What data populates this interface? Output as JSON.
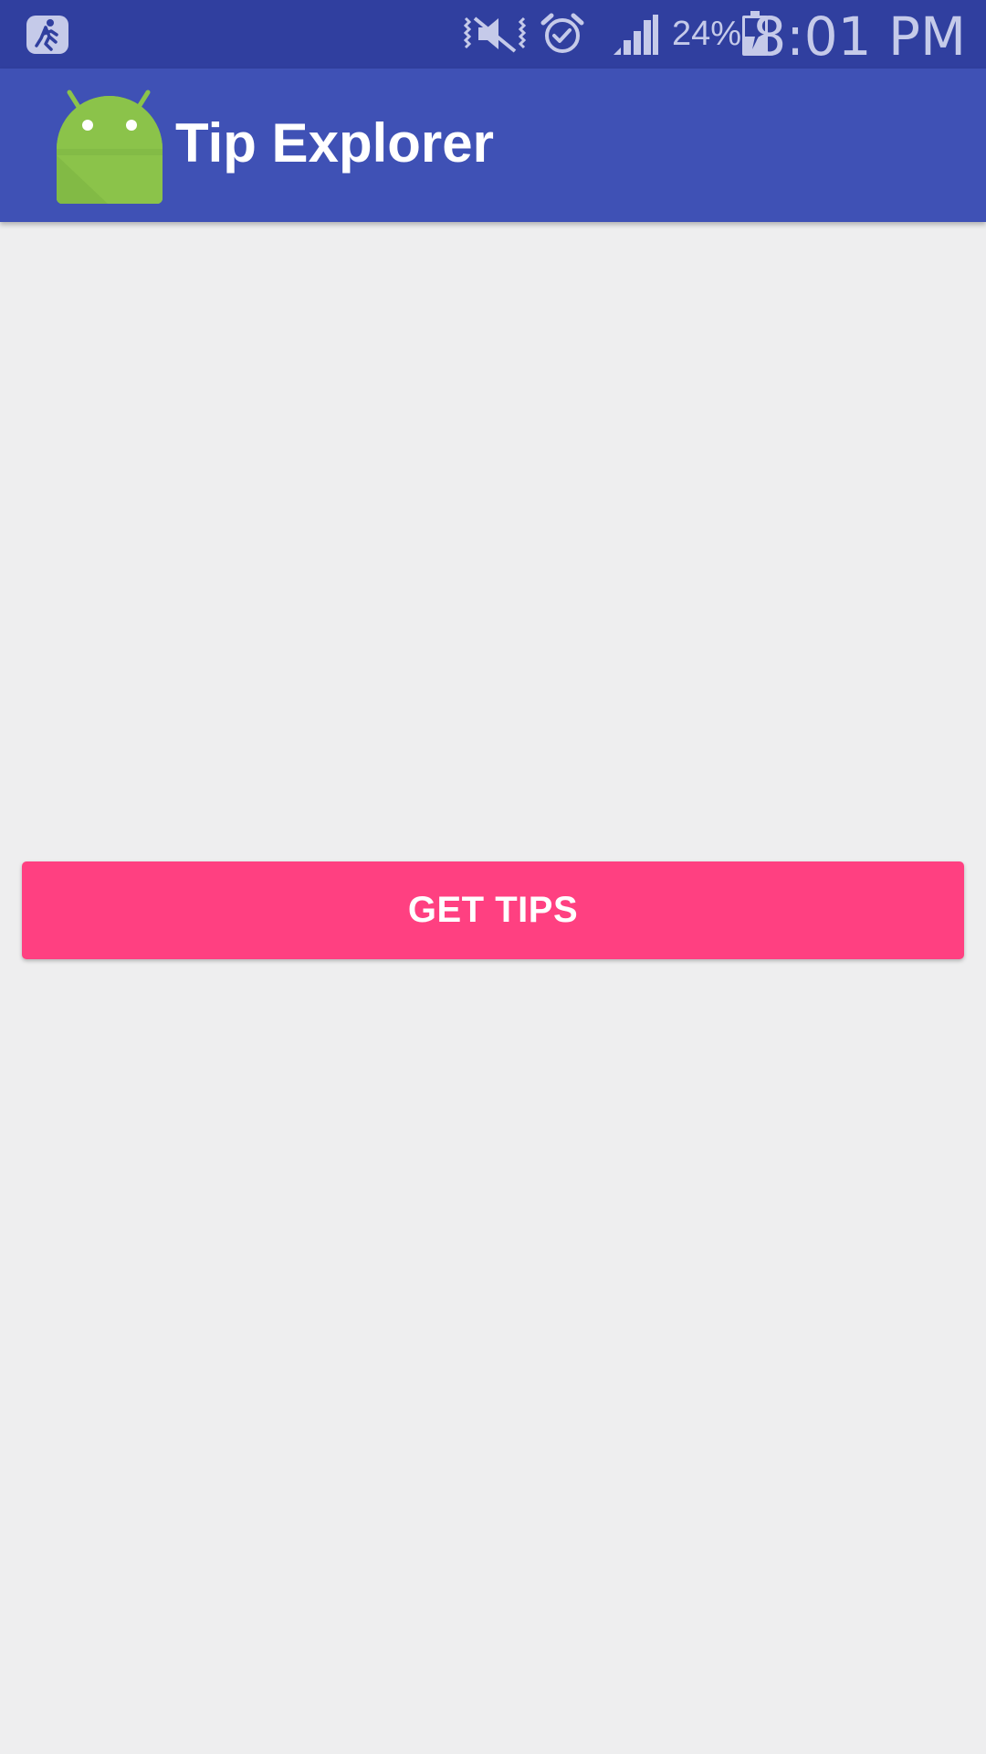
{
  "status_bar": {
    "battery_percent": "24%",
    "time": "8:01 PM",
    "icons": [
      "running-app-icon",
      "vibrate-off-icon",
      "alarm-icon",
      "signal-icon",
      "battery-charging-icon"
    ]
  },
  "app_bar": {
    "title": "Tip Explorer",
    "logo": "android-logo-icon"
  },
  "main": {
    "button_label": "GET TIPS"
  },
  "colors": {
    "status_bar": "#303f9f",
    "app_bar": "#3f51b5",
    "accent": "#ff4081",
    "background": "#eeeeef"
  }
}
